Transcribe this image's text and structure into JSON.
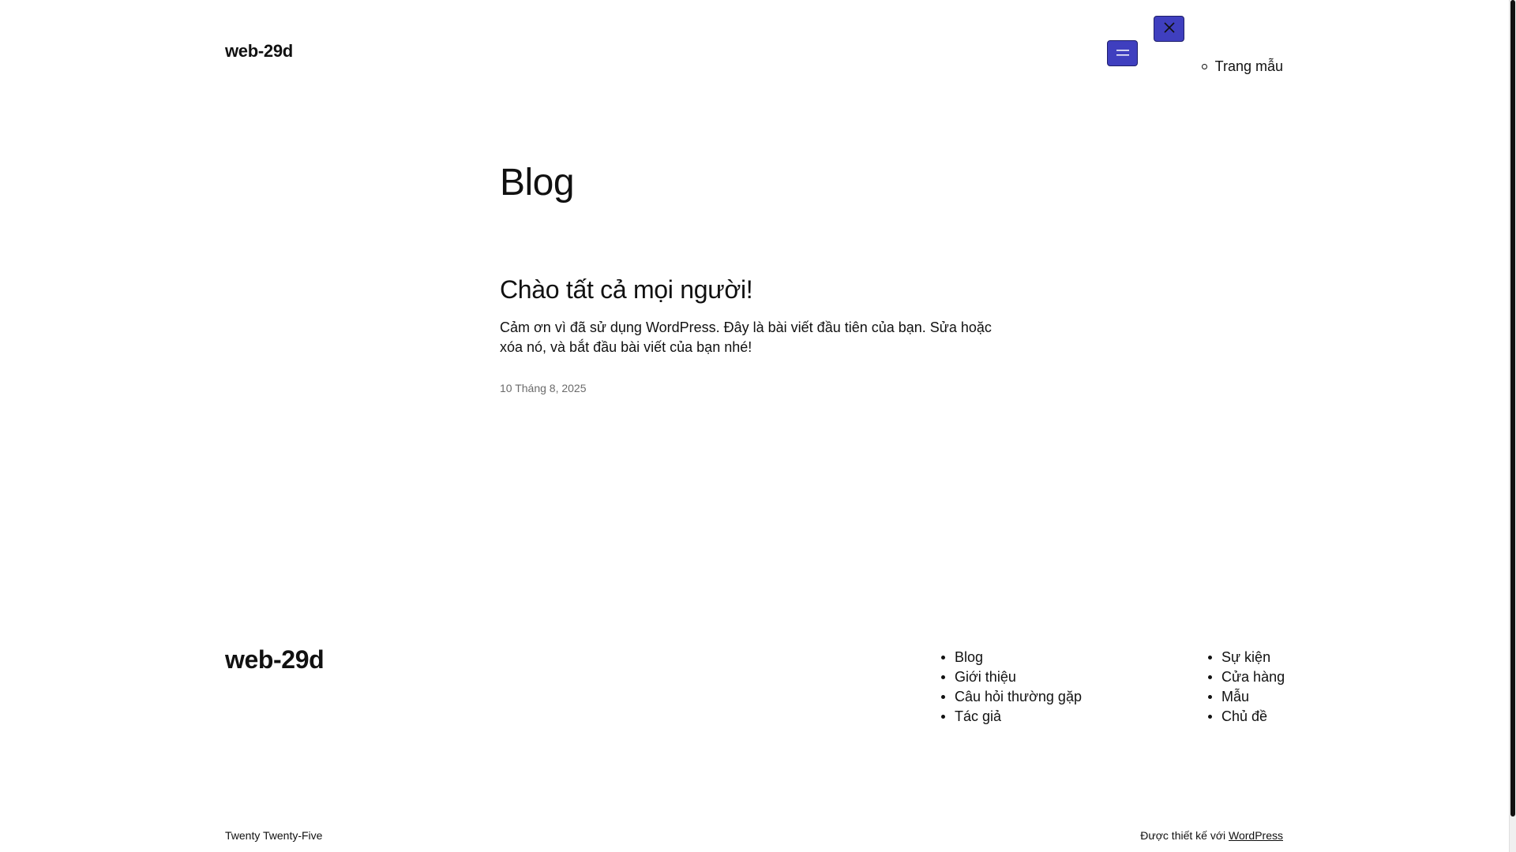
{
  "colors": {
    "accent": "#3f3fbf",
    "text": "#111111",
    "muted": "#6b6b6b",
    "background": "#ffffff"
  },
  "header": {
    "site_title": "web-29d",
    "open_menu_icon": "hamburger-icon",
    "close_menu_icon": "close-icon",
    "submenu_items": [
      "Trang mẫu"
    ]
  },
  "main": {
    "page_title": "Blog",
    "posts": [
      {
        "title": "Chào tất cả mọi người!",
        "excerpt": "Cảm ơn vì đã sử dụng WordPress. Đây là bài viết đầu tiên của bạn. Sửa hoặc xóa nó, và bắt đầu bài viết của bạn nhé!",
        "date": "10 Tháng 8, 2025"
      }
    ]
  },
  "footer": {
    "site_title": "web-29d",
    "nav_left": [
      "Blog",
      "Giới thiệu",
      "Câu hỏi thường gặp",
      "Tác giả"
    ],
    "nav_right": [
      "Sự kiện",
      "Cửa hàng",
      "Mẫu",
      "Chủ đề"
    ],
    "credit_left": "Twenty Twenty-Five",
    "credit_right_prefix": "Được thiết kế với",
    "credit_right_link": "WordPress"
  }
}
